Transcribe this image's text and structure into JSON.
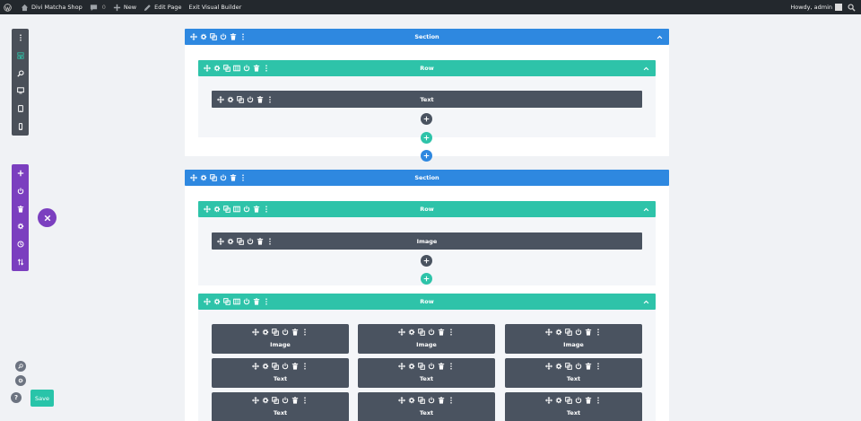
{
  "adminbar": {
    "site_name": "Divi Matcha Shop",
    "comments_count": "0",
    "new_label": "New",
    "edit_page_label": "Edit Page",
    "exit_label": "Exit Visual Builder",
    "howdy": "Howdy, admin"
  },
  "colors": {
    "section": "#2e88e0",
    "row": "#2ec3a9",
    "module": "#4a5360",
    "builder_purple": "#7b3fbf",
    "save": "#29c4a9"
  },
  "left_view_bar": [
    "more-icon",
    "wireframe-icon",
    "zoom-icon",
    "desktop-icon",
    "tablet-icon",
    "phone-icon"
  ],
  "left_action_bar": [
    "add-icon",
    "power-icon",
    "trash-icon",
    "gear-icon",
    "history-icon",
    "sort-icon"
  ],
  "save_label": "Save",
  "help_label": "?",
  "builder": {
    "section1": {
      "label": "Section",
      "row": {
        "label": "Row",
        "module": {
          "label": "Text"
        }
      }
    },
    "section2": {
      "label": "Section",
      "row1": {
        "label": "Row",
        "module": {
          "label": "Image"
        }
      },
      "row2": {
        "label": "Row",
        "modules": [
          [
            "Image",
            "Image",
            "Image"
          ],
          [
            "Text",
            "Text",
            "Text"
          ],
          [
            "Text",
            "Text",
            "Text"
          ]
        ]
      }
    }
  }
}
